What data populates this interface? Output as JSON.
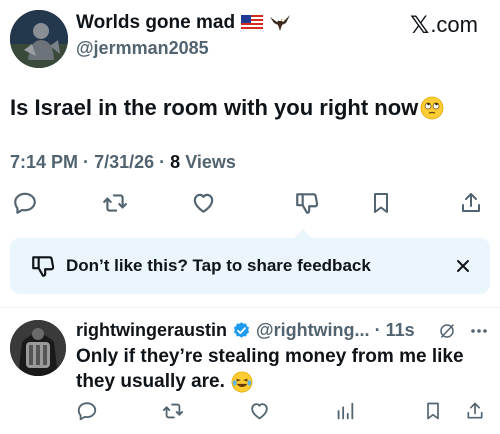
{
  "brand": {
    "label": ".com",
    "x_glyph": "𝕏"
  },
  "tweet": {
    "display_name": "Worlds gone mad",
    "name_emojis": [
      "flag-usa-icon",
      "eagle-icon"
    ],
    "handle": "@jermman2085",
    "text": "Is Israel in the room with you right now",
    "text_emoji": "eye-roll-emoji-icon",
    "time": "7:14 PM",
    "date": "7/31/26",
    "views_count": "8",
    "views_label": "Views",
    "separator": "·"
  },
  "actions": [
    "reply-icon",
    "retweet-icon",
    "like-icon",
    "dislike-icon",
    "bookmark-icon",
    "share-icon"
  ],
  "feedback": {
    "text": "Don’t like this? Tap to share feedback",
    "icon": "dislike-icon",
    "close_icon": "close-icon"
  },
  "reply": {
    "display_name": "rightwingeraustin",
    "handle": "@rightwing...",
    "separator": "·",
    "time": "11s",
    "text_line1": "Only if they’re stealing money from me like",
    "text_line2": "they usually are.",
    "text_emoji": "laughing-tears-emoji-icon",
    "actions": [
      "reply-icon",
      "retweet-icon",
      "like-icon",
      "views-icon",
      "bookmark-icon",
      "share-icon"
    ]
  },
  "colors": {
    "text": "#0f1419",
    "secondary": "#536471",
    "verified": "#1d9bf0",
    "feedback_bg": "#eaf5fc",
    "divider": "#eff3f4"
  }
}
